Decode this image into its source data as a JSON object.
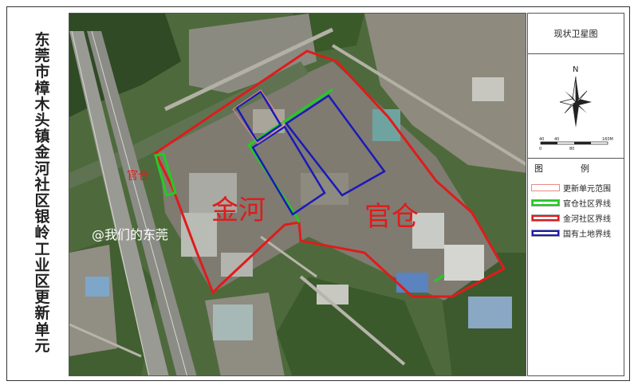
{
  "title_chars": [
    "东",
    "莞",
    "市",
    "樟",
    "木",
    "头",
    "镇",
    "金",
    "河",
    "社",
    "区",
    "银",
    "岭",
    "工",
    "业",
    "区",
    "更",
    "新",
    "单",
    "元"
  ],
  "panel_title": "现状卫星图",
  "north_label": "N",
  "scale": {
    "tick0": "0",
    "tick_a": "40",
    "tick_b": "80",
    "tick_max": "160M"
  },
  "legend": {
    "head_left": "图",
    "head_right": "例",
    "items": [
      {
        "label": "更新单元范围",
        "color": "#e88a8a",
        "style": "double"
      },
      {
        "label": "官仓社区界线",
        "color": "#22cc22",
        "style": "line"
      },
      {
        "label": "金河社区界线",
        "color": "#e01b1b",
        "style": "line"
      },
      {
        "label": "国有土地界线",
        "color": "#1a1ab8",
        "style": "line"
      }
    ]
  },
  "map_labels": {
    "jinhe": "金河",
    "guancang": "官仓",
    "guancang_small": "官仓",
    "watermark": "@我们的东莞"
  }
}
